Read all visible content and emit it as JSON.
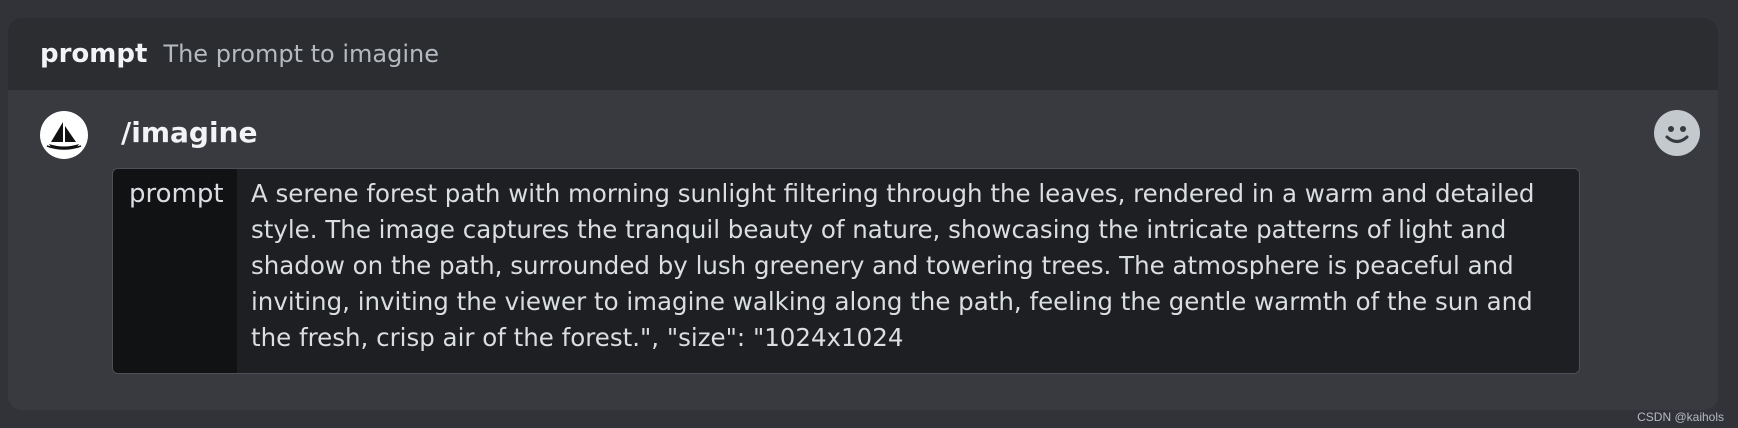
{
  "option_hint": {
    "name": "prompt",
    "description": "The prompt to imagine"
  },
  "composer": {
    "command": "/imagine",
    "avatar_icon": "midjourney-boat-icon",
    "emoji_icon": "smiley-face-icon",
    "option": {
      "label": "prompt",
      "value": "A serene forest path with morning sunlight filtering through the leaves, rendered in a warm and detailed style. The image captures the tranquil beauty of nature, showcasing the intricate patterns of light and shadow on the path, surrounded by lush greenery and towering trees. The atmosphere is peaceful and inviting, inviting the viewer to imagine walking along the path, feeling the gentle warmth of the sun and the fresh, crisp air of the forest.\",   \"size\": \"1024x1024"
    }
  },
  "watermark": "CSDN @kaihols",
  "colors": {
    "background": "#313338",
    "panel": "#383a40",
    "hint_bar": "#2b2d31",
    "option_label_bg": "#111214",
    "option_value_bg": "#1e1f22"
  }
}
